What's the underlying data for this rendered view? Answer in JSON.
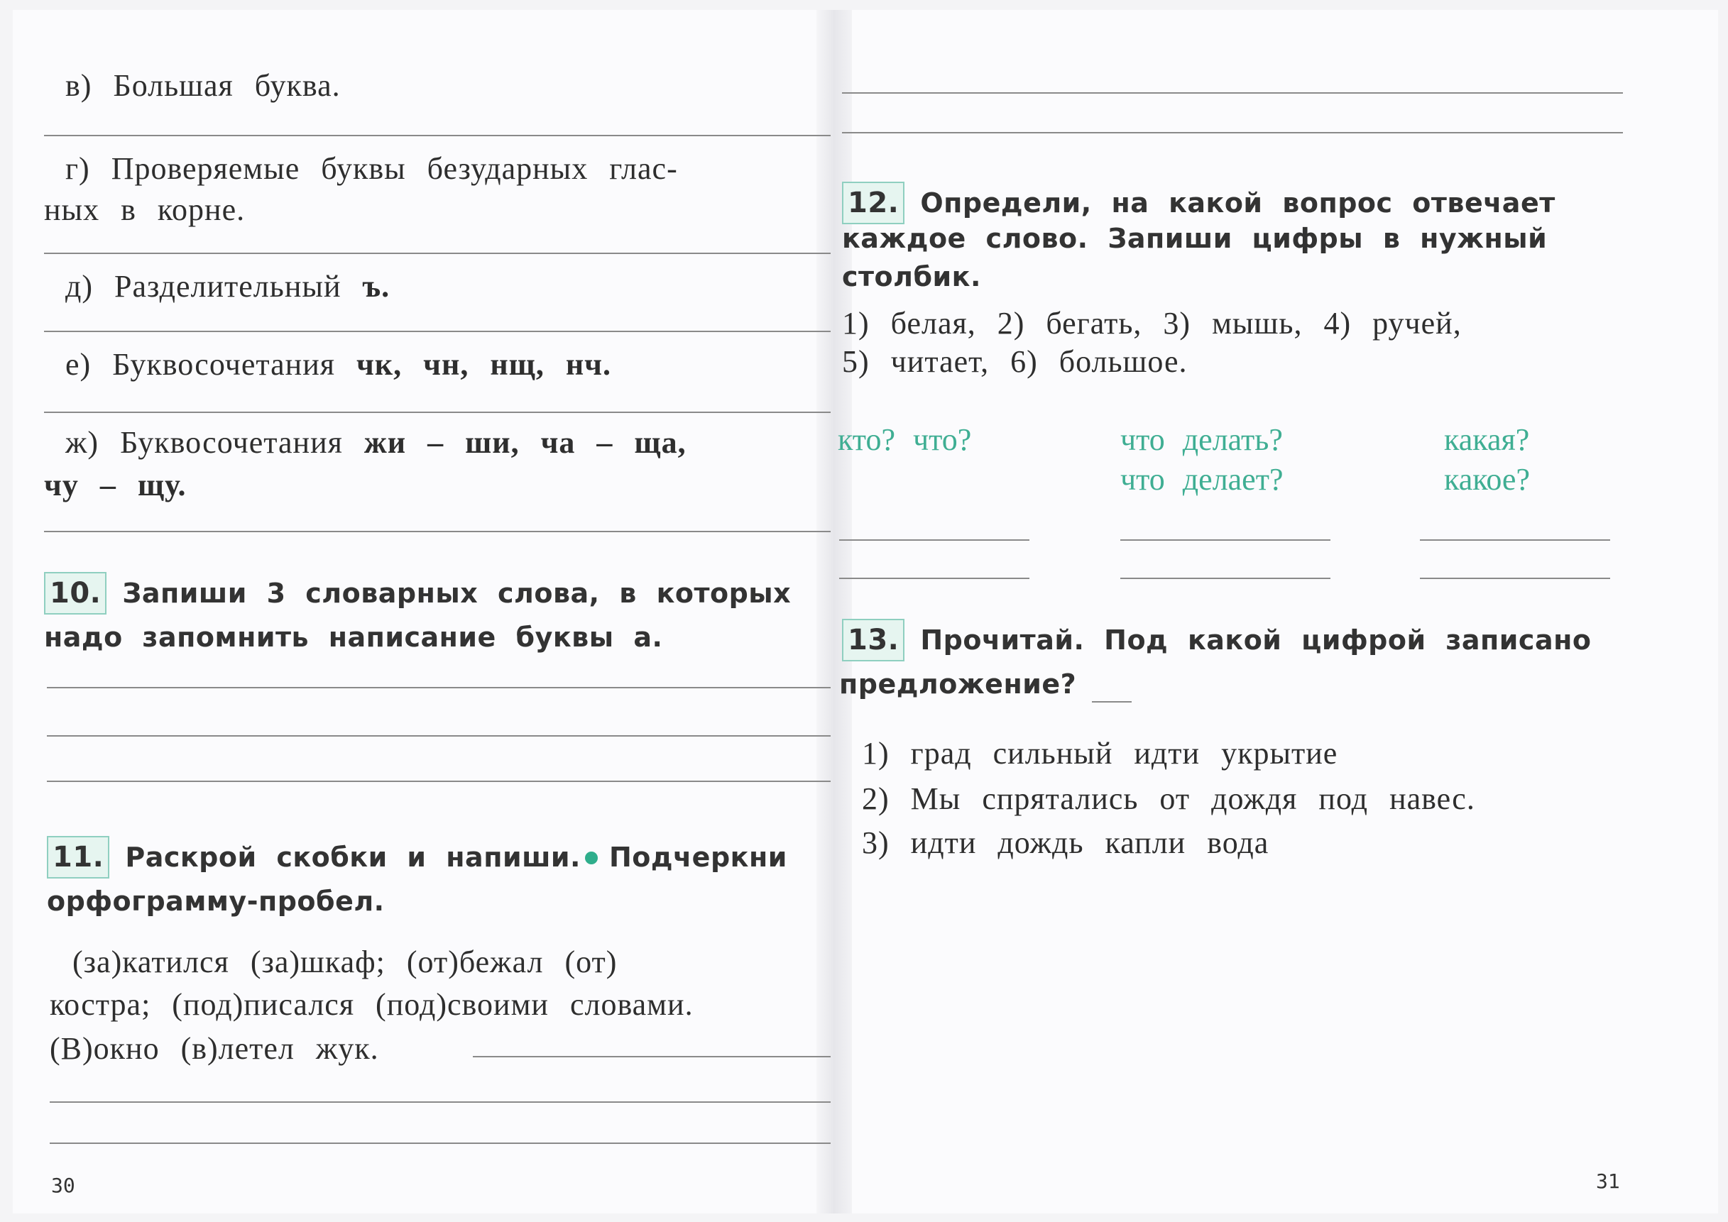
{
  "left_page": {
    "items": [
      {
        "label": "в)",
        "text": "Большая буква."
      },
      {
        "label": "г)",
        "text": "Проверяемые буквы безударных глас-",
        "text2": "ных в корне."
      },
      {
        "label": "д)",
        "text": "Разделительный",
        "bold": "ъ."
      },
      {
        "label": "е)",
        "text": "Буквосочетания",
        "bold": "чк, чн, нщ, нч."
      },
      {
        "label": "ж)",
        "text": "Буквосочетания",
        "bold": "жи – ши, ча – ща,",
        "bold2": "чу – щу."
      }
    ],
    "task10": {
      "number": "10.",
      "line1": "Запиши 3 словарных слова, в которых",
      "line2": "надо запомнить написание буквы",
      "bold": "а."
    },
    "task11": {
      "number": "11.",
      "line1a": "Раскрой скобки и напиши.",
      "line1b": "Подчеркни",
      "line2": "орфограмму-пробел.",
      "text1": "(за)катился (за)шкаф; (от)бежал (от)",
      "text2": "костра; (под)писался (под)своими словами.",
      "text3": "(В)окно (в)летел жук."
    },
    "page_number": "30"
  },
  "right_page": {
    "task12": {
      "number": "12.",
      "line1": "Определи, на какой вопрос отвечает",
      "line2": "каждое слово. Запиши цифры в нужный",
      "line3": "столбик.",
      "words1": "1) белая, 2) бегать, 3) мышь, 4) ручей,",
      "words2": "5) читает, 6) большое.",
      "columns": [
        {
          "q1": "кто? что?",
          "q2": ""
        },
        {
          "q1": "что делать?",
          "q2": "что делает?"
        },
        {
          "q1": "какая?",
          "q2": "какое?"
        }
      ]
    },
    "task13": {
      "number": "13.",
      "line1": "Прочитай. Под какой цифрой записано",
      "line2": "предложение?",
      "options": [
        "1) град сильный идти укрытие",
        "2) Мы спрятались от дождя под навес.",
        "3) идти дождь капли вода"
      ]
    },
    "page_number": "31"
  },
  "colors": {
    "accent_green": "#3fae93",
    "box_border": "#8fcfc0",
    "box_fill": "#e6f5f0"
  }
}
